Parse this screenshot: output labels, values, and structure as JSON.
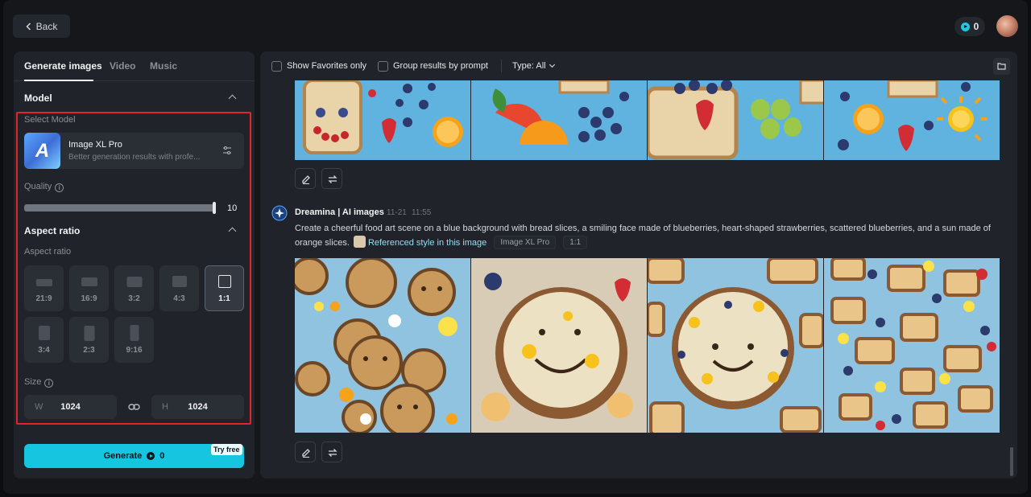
{
  "header": {
    "back_label": "Back",
    "credits_value": "0"
  },
  "left_panel": {
    "tabs": [
      {
        "label": "Generate images",
        "active": true
      },
      {
        "label": "Video",
        "active": false
      },
      {
        "label": "Music",
        "active": false
      }
    ],
    "model_section": {
      "title": "Model",
      "select_label": "Select Model",
      "model_name": "Image XL Pro",
      "model_description": "Better generation results with profe..."
    },
    "quality": {
      "label": "Quality",
      "value": "10",
      "fraction": 1.0
    },
    "aspect_section": {
      "title": "Aspect ratio",
      "subtitle": "Aspect ratio",
      "options": [
        "21:9",
        "16:9",
        "3:2",
        "4:3",
        "1:1",
        "3:4",
        "2:3",
        "9:16"
      ],
      "selected": "1:1"
    },
    "size": {
      "label": "Size",
      "width_letter": "W",
      "width_value": "1024",
      "height_letter": "H",
      "height_value": "1024"
    },
    "generate": {
      "label": "Generate",
      "cost": "0",
      "badge": "Try free"
    }
  },
  "right_panel": {
    "filters": {
      "show_favorites": "Show Favorites only",
      "group_results": "Group results by prompt",
      "type_label": "Type: All"
    },
    "result": {
      "author": "Dreamina | AI images",
      "date": "11-21",
      "time": "11:55",
      "prompt": "Create a cheerful food art scene on a blue background with bread slices, a smiling face made of blueberries, heart-shaped strawberries, scattered blueberries, and a sun made of orange slices.",
      "reference_label": "Referenced style in this image",
      "model_chip": "Image XL Pro",
      "ratio_chip": "1:1"
    }
  },
  "colors": {
    "accent": "#16c5e0",
    "highlight_border": "#e0262b",
    "panel_bg": "#202329",
    "image_bg_blue": "#5fb3de"
  },
  "icons": [
    "chevron-left-icon",
    "credits-icon",
    "chevron-up-icon",
    "tune-icon",
    "info-icon",
    "link-icon",
    "folder-icon",
    "edit-icon",
    "regenerate-icon",
    "dreamina-star-icon"
  ]
}
